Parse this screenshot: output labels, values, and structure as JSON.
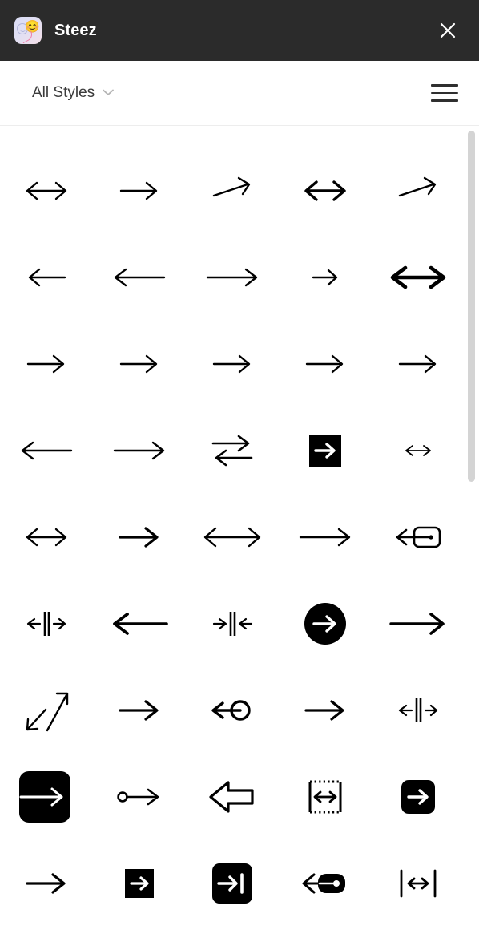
{
  "titlebar": {
    "app_name": "Steez",
    "app_icon": "steez-app-icon",
    "emoji_glyph": "😊",
    "close_icon": "close-icon",
    "background_color": "#2b2b2b",
    "title_color": "#ffffff"
  },
  "filterbar": {
    "style_filter_label": "All Styles",
    "chevron_icon": "chevron-down-icon",
    "menu_icon": "hamburger-menu-icon",
    "text_color": "#3a3a3a"
  },
  "scrollbar": {
    "thumb_color": "#d4d4d4",
    "orientation": "vertical"
  },
  "grid": {
    "columns": 5,
    "icon_color": "#000000",
    "rows": [
      [
        {
          "name": "arrow-left-right-thin",
          "glyph": "left-right"
        },
        {
          "name": "arrow-right-thin",
          "glyph": "right"
        },
        {
          "name": "arrow-right-tilted",
          "glyph": "right-tilt"
        },
        {
          "name": "arrow-left-right-bold",
          "glyph": "left-right-bold"
        },
        {
          "name": "arrow-right-tilted-bold",
          "glyph": "right-tilt"
        }
      ],
      [
        {
          "name": "arrow-left-thin",
          "glyph": "left"
        },
        {
          "name": "arrow-left-long",
          "glyph": "left-long"
        },
        {
          "name": "arrow-right-long",
          "glyph": "right-long"
        },
        {
          "name": "arrow-right-small",
          "glyph": "right-small"
        },
        {
          "name": "arrow-left-right-heavy",
          "glyph": "left-right-heavy"
        }
      ],
      [
        {
          "name": "arrow-right-plain-1",
          "glyph": "right"
        },
        {
          "name": "arrow-right-plain-2",
          "glyph": "right"
        },
        {
          "name": "arrow-right-plain-3",
          "glyph": "right"
        },
        {
          "name": "arrow-right-plain-4",
          "glyph": "right"
        },
        {
          "name": "arrow-right-plain-5",
          "glyph": "right"
        }
      ],
      [
        {
          "name": "arrow-left-medium",
          "glyph": "left-long"
        },
        {
          "name": "arrow-right-medium",
          "glyph": "right-long"
        },
        {
          "name": "arrow-exchange-icon",
          "glyph": "exchange"
        },
        {
          "name": "arrow-right-in-square-icon",
          "glyph": "square-arrow"
        },
        {
          "name": "arrow-left-right-tiny",
          "glyph": "left-right-tiny"
        }
      ],
      [
        {
          "name": "arrow-left-right-wide",
          "glyph": "left-right"
        },
        {
          "name": "arrow-right-thick",
          "glyph": "right-thick"
        },
        {
          "name": "arrow-left-right-extra-wide",
          "glyph": "left-right-wide"
        },
        {
          "name": "arrow-right-long-thin",
          "glyph": "right-long"
        },
        {
          "name": "arrow-exit-box-icon",
          "glyph": "exit-left-box"
        }
      ],
      [
        {
          "name": "expand-horizontal-icon",
          "glyph": "expand-center"
        },
        {
          "name": "arrow-left-bold-long",
          "glyph": "left-bold-long"
        },
        {
          "name": "collapse-horizontal-icon",
          "glyph": "collapse-center"
        },
        {
          "name": "arrow-right-in-circle-icon",
          "glyph": "circle-arrow"
        },
        {
          "name": "arrow-right-bold-long",
          "glyph": "right-bold-long"
        }
      ],
      [
        {
          "name": "arrow-diagonal-two-way-icon",
          "glyph": "diagonal-two-way"
        },
        {
          "name": "arrow-right-medium-2",
          "glyph": "right-thick"
        },
        {
          "name": "arrow-left-from-circle-icon",
          "glyph": "left-circle-tail"
        },
        {
          "name": "arrow-right-medium-3",
          "glyph": "right-thick"
        },
        {
          "name": "expand-horizontal-small-icon",
          "glyph": "expand-center"
        }
      ],
      [
        {
          "name": "arrow-right-filled-rounded-square-icon",
          "glyph": "rounded-square-arrow-lg"
        },
        {
          "name": "arrow-right-circle-tail-icon",
          "glyph": "circle-tail-right"
        },
        {
          "name": "arrow-left-outline-icon",
          "glyph": "outline-left"
        },
        {
          "name": "width-measure-dotted-icon",
          "glyph": "dotted-box-width"
        },
        {
          "name": "arrow-right-rounded-square-icon",
          "glyph": "rounded-square-arrow-sm"
        }
      ],
      [
        {
          "name": "arrow-right-plain-6",
          "glyph": "right-thick"
        },
        {
          "name": "arrow-right-square-icon",
          "glyph": "square-arrow-sm"
        },
        {
          "name": "arrow-to-bar-square-icon",
          "glyph": "rounded-square-arrow-bar"
        },
        {
          "name": "arrow-left-filled-tail-icon",
          "glyph": "left-filled-tail"
        },
        {
          "name": "width-measure-icon",
          "glyph": "width-measure"
        }
      ]
    ]
  }
}
